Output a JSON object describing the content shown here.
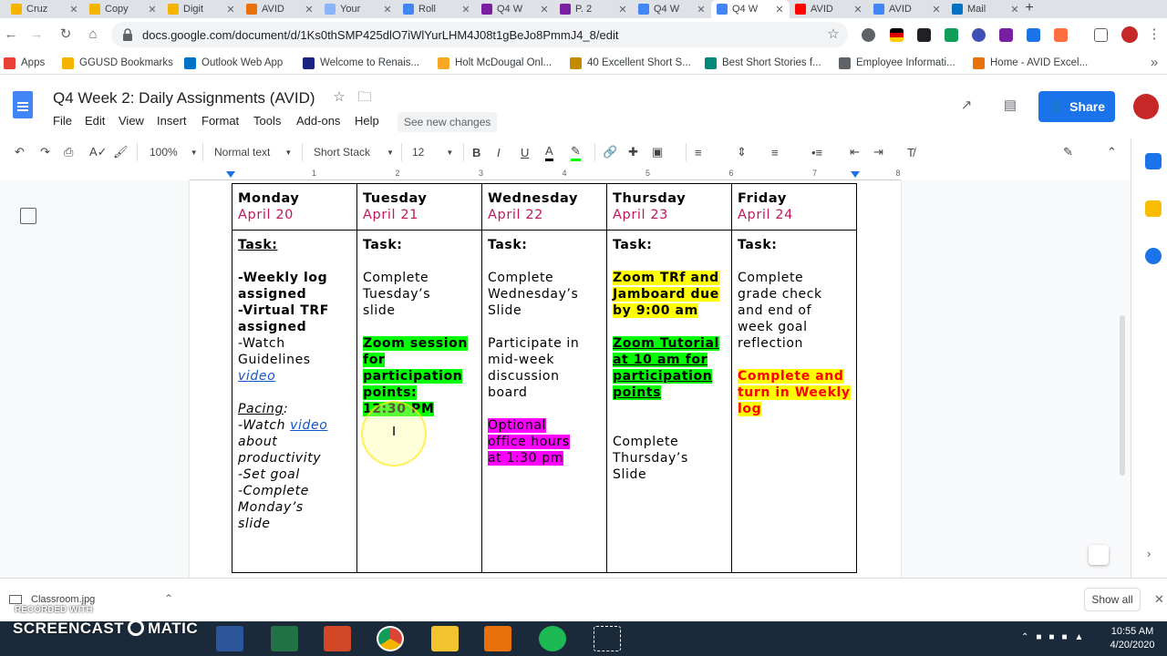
{
  "browser": {
    "tabs": [
      {
        "title": "Cruz",
        "color": "#f4b400"
      },
      {
        "title": "Copy",
        "color": "#f4b400"
      },
      {
        "title": "Digit",
        "color": "#f4b400"
      },
      {
        "title": "AVID",
        "color": "#e8710a"
      },
      {
        "title": "Your",
        "color": "#8ab4f8"
      },
      {
        "title": "Roll",
        "color": "#4285f4"
      },
      {
        "title": "Q4 W",
        "color": "#7b1fa2"
      },
      {
        "title": "P. 2",
        "color": "#7b1fa2"
      },
      {
        "title": "Q4 W",
        "color": "#4285f4"
      },
      {
        "title": "Q4 W",
        "color": "#4285f4"
      },
      {
        "title": "AVID",
        "color": "#ff0000"
      },
      {
        "title": "AVID",
        "color": "#4285f4"
      },
      {
        "title": "Mail",
        "color": "#0072c6"
      }
    ],
    "url": "docs.google.com/document/d/1Ks0thSMP425dlO7iWlYurLHM4J08t1gBeJo8PmmJ4_8/edit",
    "bookmarks": [
      {
        "label": "Apps",
        "color": "#e94235"
      },
      {
        "label": "GGUSD Bookmarks",
        "color": "#f4b400"
      },
      {
        "label": "Outlook Web App",
        "color": "#0072c6"
      },
      {
        "label": "Welcome to Renais...",
        "color": "#1a237e"
      },
      {
        "label": "Holt McDougal Onl...",
        "color": "#f9a825"
      },
      {
        "label": "40 Excellent Short S...",
        "color": "#c48a00"
      },
      {
        "label": "Best Short Stories f...",
        "color": "#00897b"
      },
      {
        "label": "Employee Informati...",
        "color": "#5f6368"
      },
      {
        "label": "Home - AVID Excel...",
        "color": "#e8710a"
      }
    ]
  },
  "docs": {
    "title": "Q4 Week 2: Daily Assignments (AVID)",
    "menus": [
      "File",
      "Edit",
      "View",
      "Insert",
      "Format",
      "Tools",
      "Add-ons",
      "Help"
    ],
    "see_new_changes": "See new changes",
    "share": "Share",
    "toolbar": {
      "zoom": "100%",
      "style": "Normal text",
      "font": "Short Stack",
      "size": "12"
    },
    "ruler": [
      "1",
      "2",
      "3",
      "4",
      "5",
      "6",
      "7",
      "8"
    ]
  },
  "schedule": {
    "days": [
      {
        "day": "Monday",
        "date": "April 20"
      },
      {
        "day": "Tuesday",
        "date": "April 21"
      },
      {
        "day": "Wednesday",
        "date": "April 22"
      },
      {
        "day": "Thursday",
        "date": "April 23"
      },
      {
        "day": "Friday",
        "date": "April 24"
      }
    ],
    "task_label": "Task:",
    "monday": {
      "l1": "-Weekly log",
      "l2": "assigned",
      "l3": "-Virtual TRF",
      "l4": "assigned",
      "l5": "-Watch",
      "l6": "Guidelines",
      "video": "video",
      "pacing": "Pacing",
      "pacing_colon": ":",
      "p1": "-Watch ",
      "p1_video": "video",
      "p2": "about",
      "p3": "productivity",
      "p4": "-Set goal",
      "p5": "-Complete",
      "p6": "Monday’s",
      "p7": "slide"
    },
    "tuesday": {
      "l1": "Complete",
      "l2": "Tuesday’s",
      "l3": "slide",
      "zoom1": "Zoom session",
      "zoom2": "for",
      "zoom3": "participation",
      "zoom4": "points:",
      "zoom5": "12:30 PM"
    },
    "wednesday": {
      "l1": "Complete",
      "l2": "Wednesday’s",
      "l3": "Slide",
      "p1": "Participate in",
      "p2": "mid-week",
      "p3": "discussion",
      "p4": "board",
      "o1": "Optional",
      "o2": "office hours",
      "o3": "at 1:30 pm"
    },
    "thursday": {
      "y1": "Zoom TRf and",
      "y2": "Jamboard due",
      "y3": "by 9:00 am",
      "g1": "Zoom Tutorial",
      "g2": "at 10 am for",
      "g3": "participation",
      "g4": "points",
      "c1": "Complete",
      "c2": "Thursday’s",
      "c3": "Slide"
    },
    "friday": {
      "l1": "Complete",
      "l2": "grade check",
      "l3": "and end of",
      "l4": "week goal",
      "l5": "reflection",
      "r1": "Complete and",
      "r2": "turn in Weekly",
      "r3": "log"
    }
  },
  "downloads": {
    "file": "Classroom.jpg",
    "show_all": "Show all"
  },
  "watermark": {
    "recorded": "RECORDED WITH",
    "brand": "SCREENCAST",
    "brand2": "MATIC"
  },
  "clock": {
    "time": "10:55 AM",
    "date": "4/20/2020"
  }
}
